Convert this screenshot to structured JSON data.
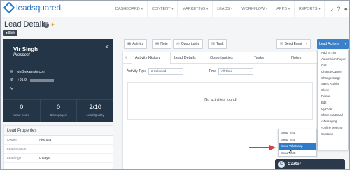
{
  "brand": {
    "logo_text": "leadsquared"
  },
  "nav": {
    "items": [
      "DASHBOARD",
      "CONTENT",
      "MARKETING",
      "LEADS",
      "WORKFLOW",
      "APPS",
      "REPORTS"
    ],
    "icons": [
      "bell-icon",
      "help-icon",
      "user-icon"
    ]
  },
  "page": {
    "title": "Lead Details",
    "back_label": "Back"
  },
  "profile": {
    "name": "Vir Singh",
    "stage": "Prospect",
    "email": "vir@example.com",
    "phone": "+91-9",
    "stats": [
      {
        "value": "0",
        "label": "Lead Score"
      },
      {
        "value": "0",
        "label": "Disengaged"
      },
      {
        "value": "2/10",
        "label": "Lead Quality"
      }
    ]
  },
  "properties": {
    "heading": "Lead Properties",
    "rows": [
      {
        "key": "Owner",
        "value": "Akshata"
      },
      {
        "key": "Lead Source",
        "value": ""
      },
      {
        "key": "Lead Age",
        "value": "0 Days"
      }
    ]
  },
  "toolbar": {
    "activity": "Activity",
    "note": "Note",
    "opportunity": "Opportunity",
    "task": "Task",
    "send_email": "Send Email",
    "lead_actions": "Lead Actions"
  },
  "tabs": [
    "Activity History",
    "Lead Details",
    "Opportunities",
    "Tasks",
    "Notes"
  ],
  "filters": {
    "activity_type_label": "Activity Type",
    "activity_type_value": "2 Selected",
    "time_label": "Time",
    "time_value": "All Time"
  },
  "empty_message": "No activities found!",
  "lead_actions_menu": [
    "Add To List",
    "Automation Report",
    "Call",
    "Change Owner",
    "Change Stage",
    "Sales Activity",
    "Clone",
    "Delete",
    "Edit",
    "Opt-Out",
    "Share Via Email",
    "Messaging",
    "Online Meeting",
    "Customs"
  ],
  "submenu": [
    "Send Text",
    "Send Text",
    "Send Whatsapp",
    "Send SMS"
  ],
  "chat": {
    "name": "Carter",
    "initial": "C"
  },
  "colors": {
    "accent": "#3b81c9",
    "profile_bg": "#243548",
    "arrow": "#e03a3a"
  }
}
